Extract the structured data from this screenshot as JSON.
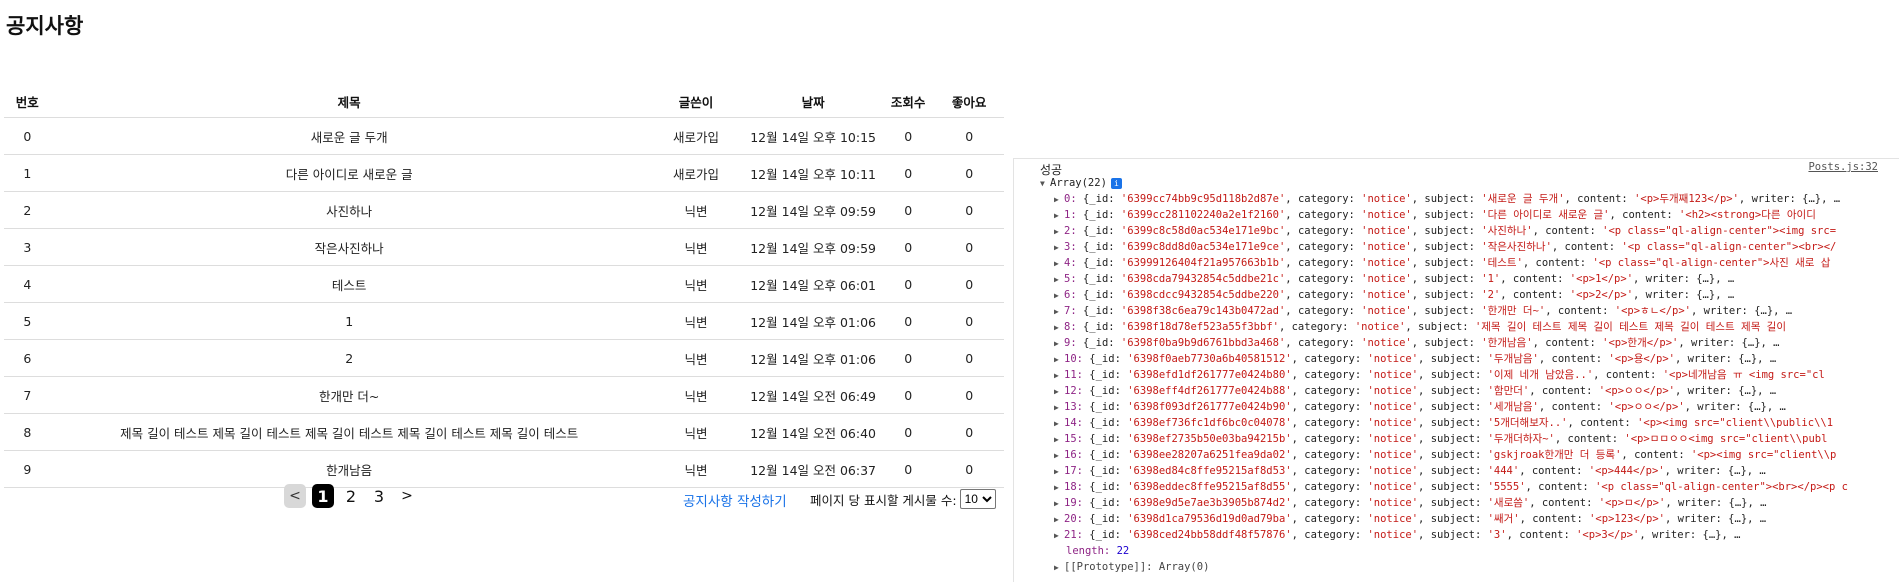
{
  "page": {
    "title": "공지사항"
  },
  "table": {
    "headers": {
      "no": "번호",
      "subject": "제목",
      "writer": "글쓴이",
      "date": "날짜",
      "views": "조회수",
      "likes": "좋아요"
    },
    "rows": [
      {
        "no": "0",
        "subject": "새로운 글 두개",
        "writer": "새로가입",
        "date": "12월 14일 오후 10:15",
        "views": "0",
        "likes": "0"
      },
      {
        "no": "1",
        "subject": "다른 아이디로 새로운 글",
        "writer": "새로가입",
        "date": "12월 14일 오후 10:11",
        "views": "0",
        "likes": "0"
      },
      {
        "no": "2",
        "subject": "사진하나",
        "writer": "닉변",
        "date": "12월 14일 오후 09:59",
        "views": "0",
        "likes": "0"
      },
      {
        "no": "3",
        "subject": "작은사진하나",
        "writer": "닉변",
        "date": "12월 14일 오후 09:59",
        "views": "0",
        "likes": "0"
      },
      {
        "no": "4",
        "subject": "테스트",
        "writer": "닉변",
        "date": "12월 14일 오후 06:01",
        "views": "0",
        "likes": "0"
      },
      {
        "no": "5",
        "subject": "1",
        "writer": "닉변",
        "date": "12월 14일 오후 01:06",
        "views": "0",
        "likes": "0"
      },
      {
        "no": "6",
        "subject": "2",
        "writer": "닉변",
        "date": "12월 14일 오후 01:06",
        "views": "0",
        "likes": "0"
      },
      {
        "no": "7",
        "subject": "한개만 더~",
        "writer": "닉변",
        "date": "12월 14일 오전 06:49",
        "views": "0",
        "likes": "0"
      },
      {
        "no": "8",
        "subject": "제목 길이 테스트 제목 길이 테스트 제목 길이 테스트 제목 길이 테스트 제목 길이 테스트",
        "writer": "닉변",
        "date": "12월 14일 오전 06:40",
        "views": "0",
        "likes": "0"
      },
      {
        "no": "9",
        "subject": "한개남음",
        "writer": "닉변",
        "date": "12월 14일 오전 06:37",
        "views": "0",
        "likes": "0"
      }
    ]
  },
  "pagination": {
    "prev": "<",
    "pages": [
      "1",
      "2",
      "3"
    ],
    "active": "1",
    "next": ">"
  },
  "actions": {
    "write_link": "공지사항 작성하기",
    "per_page_label": "페이지 당 표시할 게시물 수:",
    "per_page_value": "10",
    "per_page_options": [
      "10"
    ]
  },
  "console": {
    "message": "성공",
    "source": "Posts.js:32",
    "array_header": "Array(22)",
    "length_label": "length:",
    "length_value": "22",
    "prototype": "[[Prototype]]: Array(0)",
    "entries": [
      {
        "idx": "0:",
        "id": "'6399cc74bb9c95d118b2d87e'",
        "category": "'notice'",
        "subject": "'새로운 글 두개'",
        "content": "'<p>두개째123</p>'",
        "tail": ", writer: {…}, …"
      },
      {
        "idx": "1:",
        "id": "'6399cc281102240a2e1f2160'",
        "category": "'notice'",
        "subject": "'다른 아이디로 새로운 글'",
        "content": "'<h2><strong>다른 아이디",
        "tail": ""
      },
      {
        "idx": "2:",
        "id": "'6399c8c58d0ac534e171e9bc'",
        "category": "'notice'",
        "subject": "'사진하나'",
        "content": "'<p class=\"ql-align-center\"><img src=",
        "tail": ""
      },
      {
        "idx": "3:",
        "id": "'6399c8dd8d0ac534e171e9ce'",
        "category": "'notice'",
        "subject": "'작은사진하나'",
        "content": "'<p class=\"ql-align-center\"><br></",
        "tail": ""
      },
      {
        "idx": "4:",
        "id": "'63999126404f21a957663b1b'",
        "category": "'notice'",
        "subject": "'테스트'",
        "content": "'<p class=\"ql-align-center\">사진 새로 삽",
        "tail": ""
      },
      {
        "idx": "5:",
        "id": "'6398cda79432854c5ddbe21c'",
        "category": "'notice'",
        "subject": "'1'",
        "content": "'<p>1</p>'",
        "tail": ", writer: {…}, …"
      },
      {
        "idx": "6:",
        "id": "'6398cdcc9432854c5ddbe220'",
        "category": "'notice'",
        "subject": "'2'",
        "content": "'<p>2</p>'",
        "tail": ", writer: {…}, …"
      },
      {
        "idx": "7:",
        "id": "'6398f38c6ea79c143b0472ad'",
        "category": "'notice'",
        "subject": "'한개만 더~'",
        "content": "'<p>ㅎㄴ</p>'",
        "tail": ", writer: {…}, …"
      },
      {
        "idx": "8:",
        "id": "'6398f18d78ef523a55f3bbf'",
        "category": "'notice'",
        "subject": "'제목 길이 테스트 제목 길이 테스트 제목 길이 테스트 제목 길이",
        "content": "",
        "tail": ""
      },
      {
        "idx": "9:",
        "id": "'6398f0ba9b9d6761bbd3a468'",
        "category": "'notice'",
        "subject": "'한개남음'",
        "content": "'<p>한개</p>'",
        "tail": ", writer: {…}, …"
      },
      {
        "idx": "10:",
        "id": "'6398f0aeb7730a6b40581512'",
        "category": "'notice'",
        "subject": "'두개남음'",
        "content": "'<p>용</p>'",
        "tail": ", writer: {…}, …"
      },
      {
        "idx": "11:",
        "id": "'6398efd1df261777e0424b80'",
        "category": "'notice'",
        "subject": "'이제 네개 남았음..'",
        "content": "'<p>네개남음 ㅠ <img src=\"cl",
        "tail": ""
      },
      {
        "idx": "12:",
        "id": "'6398eff4df261777e0424b88'",
        "category": "'notice'",
        "subject": "'함만더'",
        "content": "'<p>ㅇㅇ</p>'",
        "tail": ", writer: {…}, …"
      },
      {
        "idx": "13:",
        "id": "'6398f093df261777e0424b90'",
        "category": "'notice'",
        "subject": "'세개남음'",
        "content": "'<p>ㅇㅇ</p>'",
        "tail": ", writer: {…}, …"
      },
      {
        "idx": "14:",
        "id": "'6398ef736fc1df6bc0c04078'",
        "category": "'notice'",
        "subject": "'5개더해보자..'",
        "content": "'<p><img src=\"client\\\\public\\\\1",
        "tail": ""
      },
      {
        "idx": "15:",
        "id": "'6398ef2735b50e03ba94215b'",
        "category": "'notice'",
        "subject": "'두개더하자~'",
        "content": "'<p>ㅁㅁㅇㅇ<img src=\"client\\\\publ",
        "tail": ""
      },
      {
        "idx": "16:",
        "id": "'6398ee28207a6251fea9da02'",
        "category": "'notice'",
        "subject": "'gskjroak한개만 더 등록'",
        "content": "'<p><img src=\"client\\\\p",
        "tail": ""
      },
      {
        "idx": "17:",
        "id": "'6398ed84c8ffe95215af8d53'",
        "category": "'notice'",
        "subject": "'444'",
        "content": "'<p>444</p>'",
        "tail": ", writer: {…}, …"
      },
      {
        "idx": "18:",
        "id": "'6398eddec8ffe95215af8d55'",
        "category": "'notice'",
        "subject": "'5555'",
        "content": "'<p class=\"ql-align-center\"><br></p><p c",
        "tail": ""
      },
      {
        "idx": "19:",
        "id": "'6398e9d5e7ae3b3905b874d2'",
        "category": "'notice'",
        "subject": "'새로씀'",
        "content": "'<p>ㅁ</p>'",
        "tail": ", writer: {…}, …"
      },
      {
        "idx": "20:",
        "id": "'6398d1ca79536d19d0ad79ba'",
        "category": "'notice'",
        "subject": "'쌔거'",
        "content": "'<p>123</p>'",
        "tail": ", writer: {…}, …"
      },
      {
        "idx": "21:",
        "id": "'6398ced24bb58ddf48f57876'",
        "category": "'notice'",
        "subject": "'3'",
        "content": "'<p>3</p>'",
        "tail": ", writer: {…}, …"
      }
    ]
  }
}
